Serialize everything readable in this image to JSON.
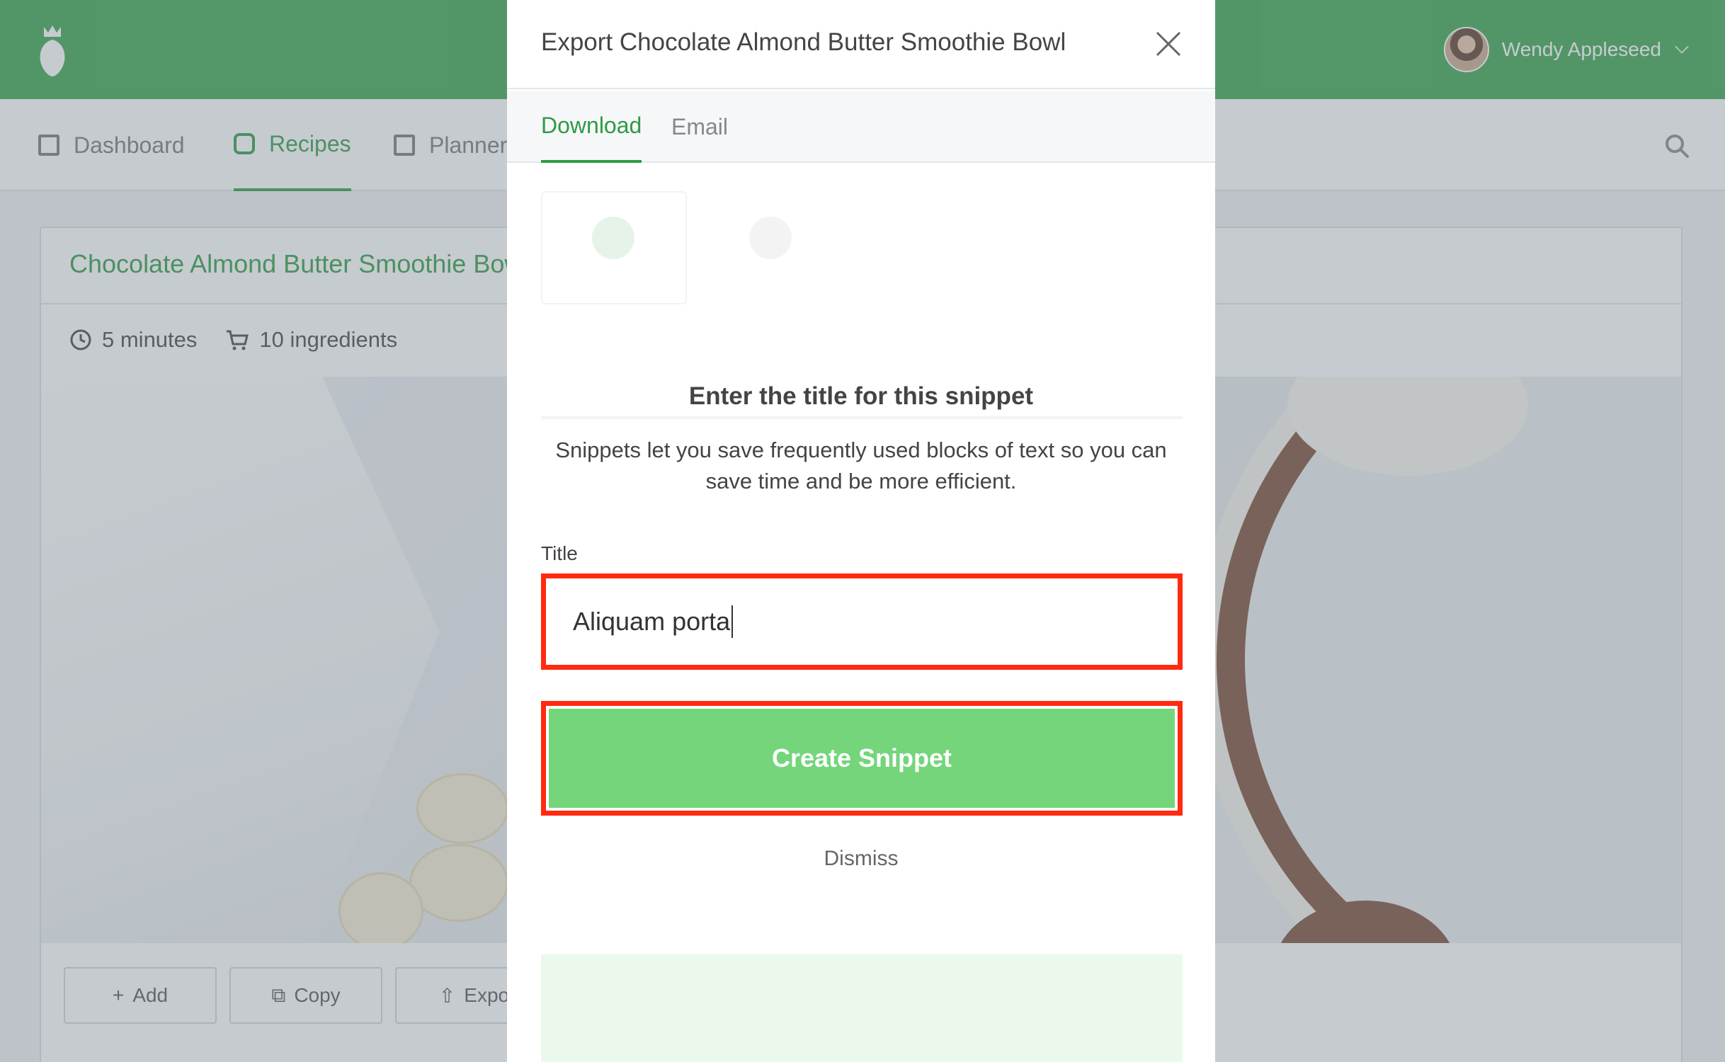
{
  "header": {
    "user_name": "Wendy Appleseed"
  },
  "nav": {
    "items": [
      {
        "label": "Dashboard",
        "icon": "dashboard-icon"
      },
      {
        "label": "Recipes",
        "icon": "recipes-icon",
        "active": true
      },
      {
        "label": "Planner",
        "icon": "calendar-icon"
      }
    ]
  },
  "recipe": {
    "title": "Chocolate Almond Butter Smoothie Bowl",
    "time": "5 minutes",
    "ingredients": "10 ingredients",
    "actions": [
      "Add",
      "Copy",
      "Export"
    ]
  },
  "modal": {
    "title": "Export Chocolate Almond Butter Smoothie Bowl",
    "tabs": [
      "Download",
      "Email"
    ],
    "active_tab": "Download"
  },
  "snippet": {
    "heading": "Enter the title for this snippet",
    "description": "Snippets let you save frequently used blocks of text so you can save time and be more efficient.",
    "title_label": "Title",
    "title_value": "Aliquam porta",
    "create_label": "Create Snippet",
    "dismiss_label": "Dismiss"
  },
  "colors": {
    "brand_green": "#38a44d",
    "accent_green": "#2e9a43",
    "button_green": "#74d57b",
    "highlight_red": "#ff2a0f"
  }
}
